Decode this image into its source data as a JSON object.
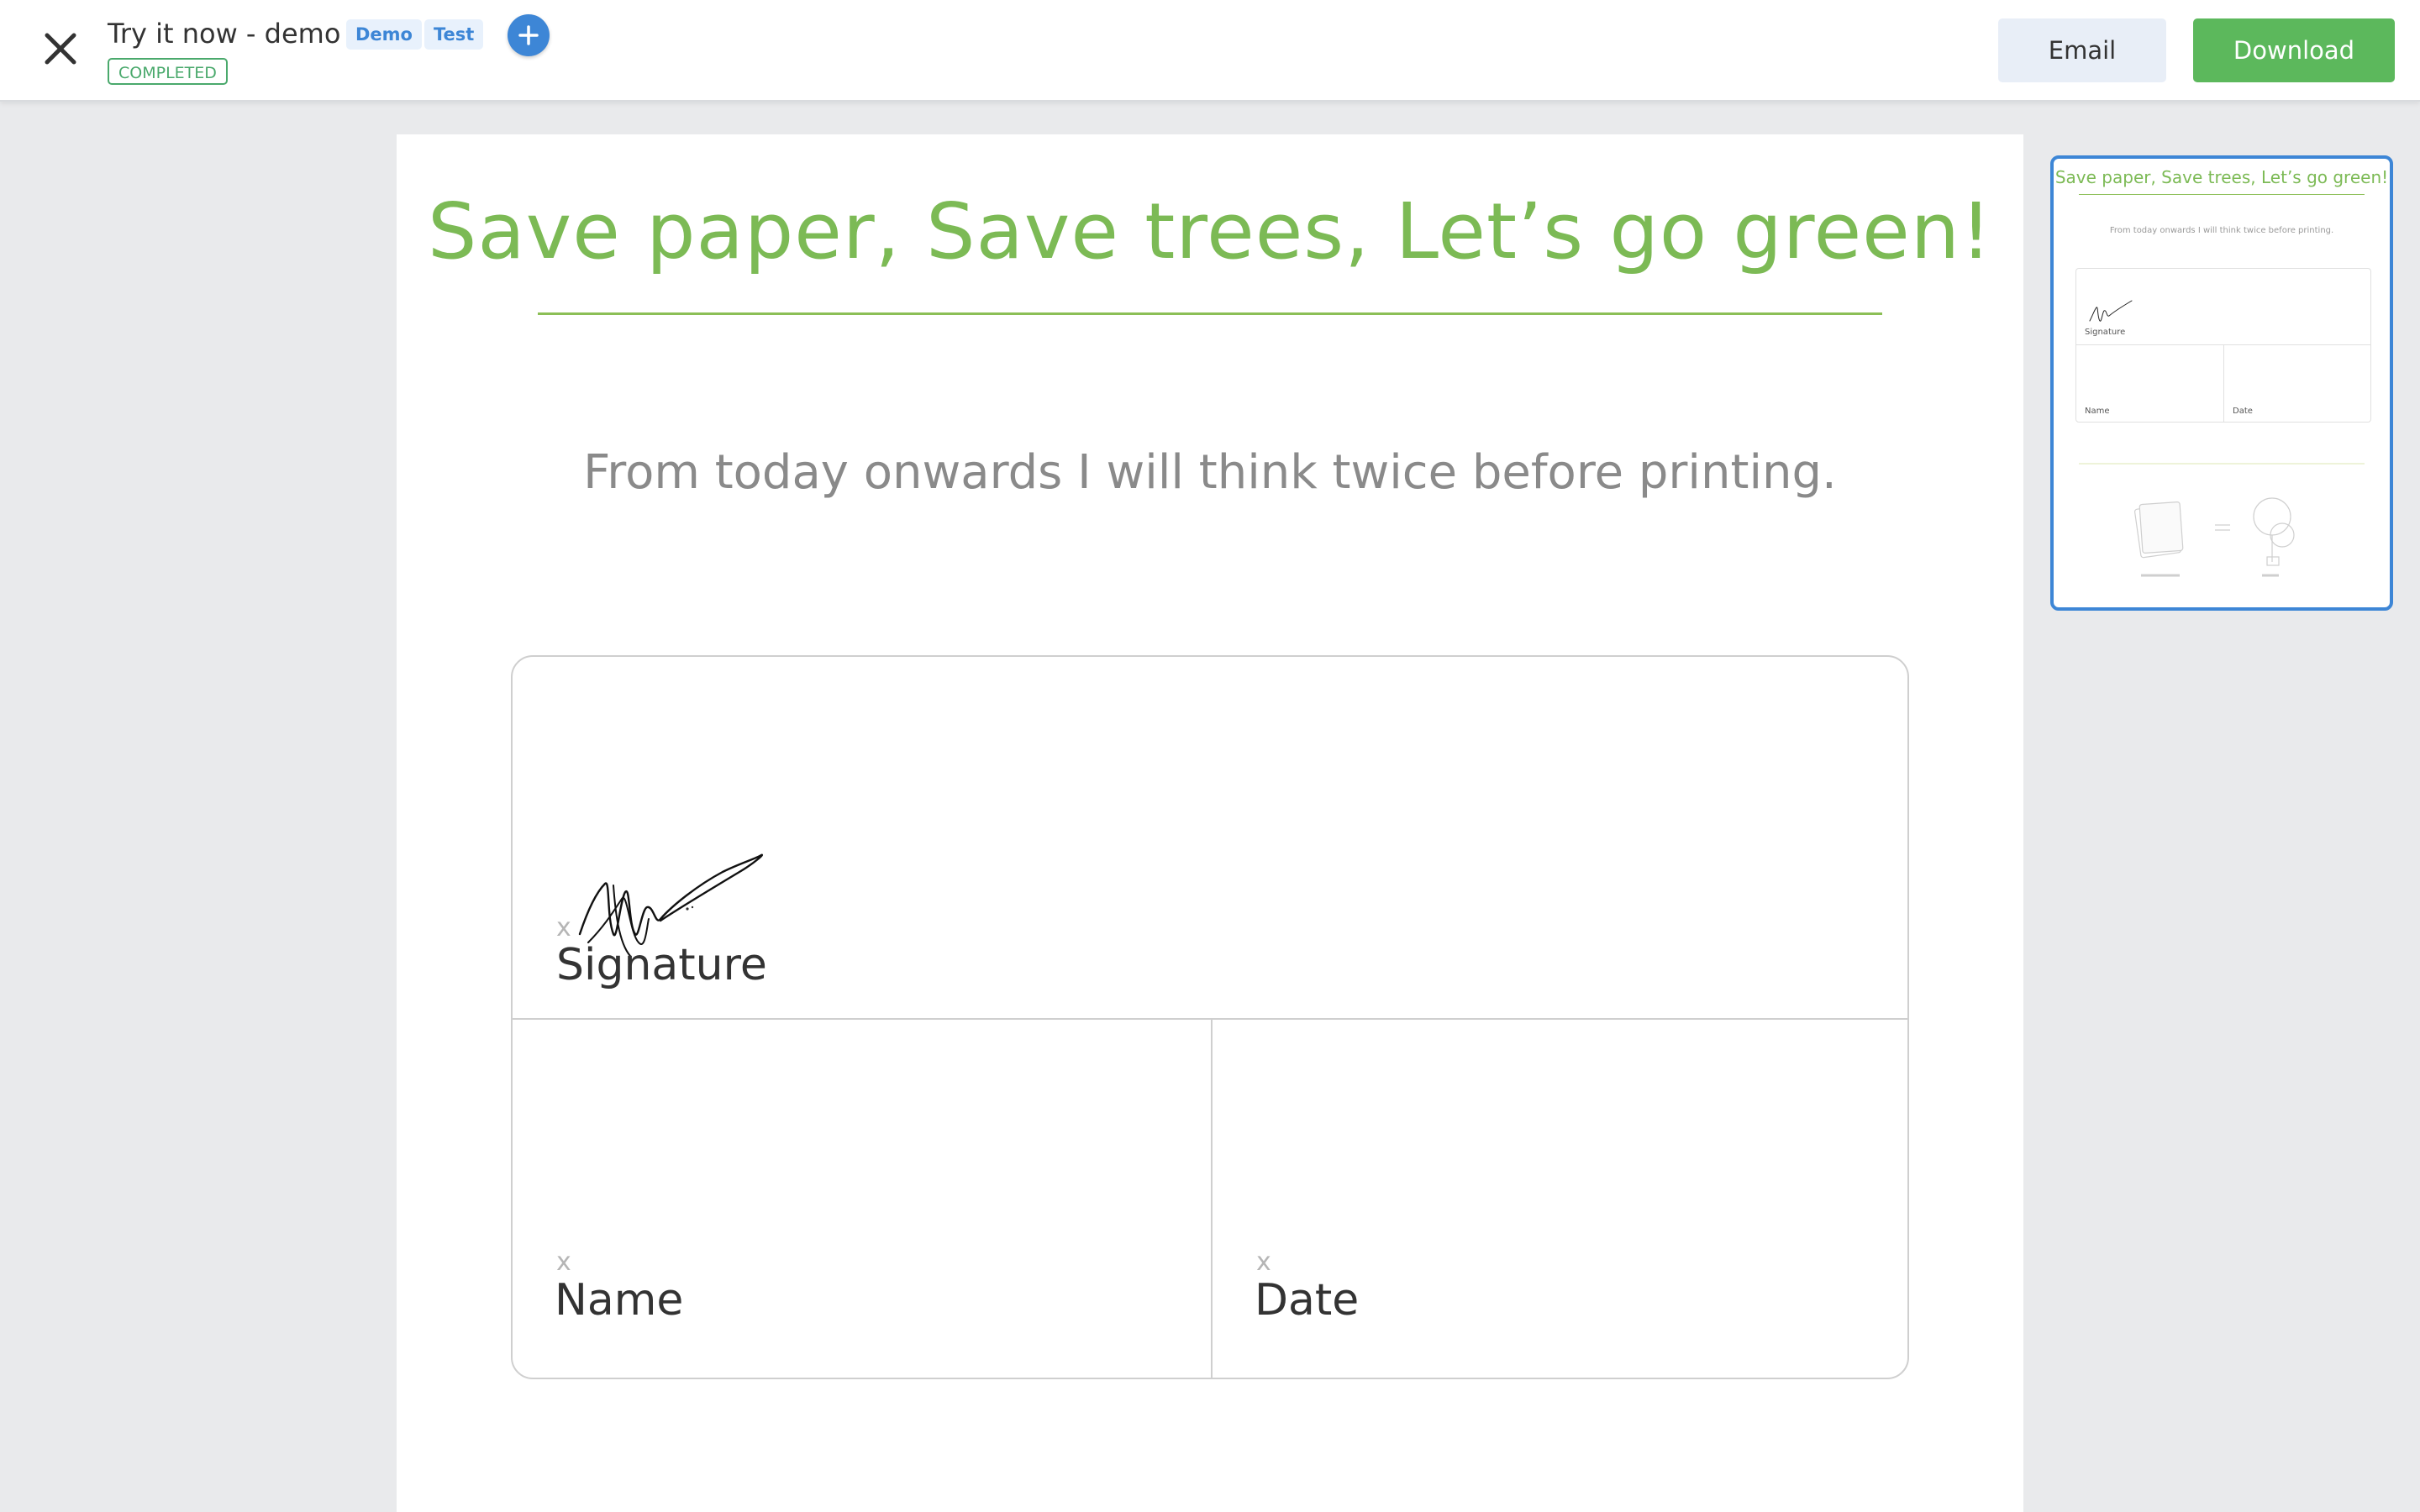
{
  "header": {
    "title": "Try it now - demo",
    "tags": [
      "Demo",
      "Test"
    ],
    "status": "COMPLETED",
    "email_label": "Email",
    "download_label": "Download"
  },
  "document": {
    "heading": "Save paper, Save trees, Let’s go green!",
    "subheading": "From today onwards I will think twice before printing.",
    "fields": {
      "signature_x": "x",
      "signature_label": "Signature",
      "name_x": "x",
      "name_label": "Name",
      "date_x": "x",
      "date_label": "Date"
    }
  },
  "thumbnail": {
    "heading": "Save paper, Save trees, Let’s go green!",
    "subheading": "From today onwards I will think twice before printing.",
    "signature_label": "Signature",
    "name_label": "Name",
    "date_label": "Date"
  },
  "colors": {
    "accent_green": "#7cba55",
    "primary_blue": "#3d86d6",
    "download_green": "#5cb85c",
    "status_green": "#4aa96c"
  },
  "icons": [
    "close-icon",
    "plus-icon"
  ]
}
